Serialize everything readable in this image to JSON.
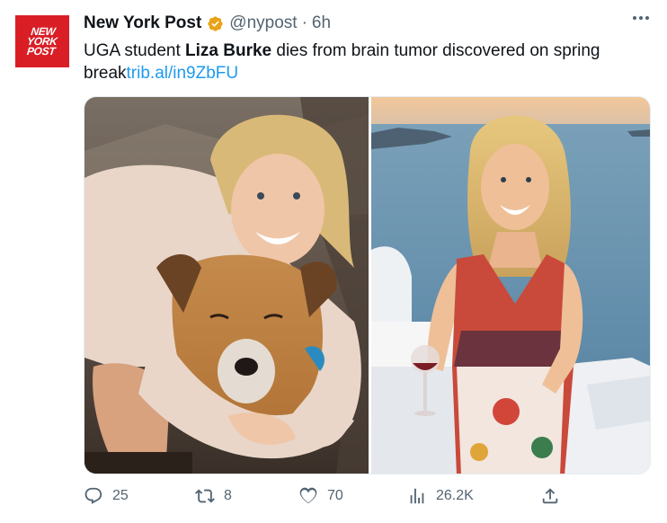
{
  "account": {
    "avatar_logo_lines": [
      "NEW",
      "YORK",
      "POST"
    ],
    "name": "New York Post",
    "handle": "@nypost",
    "separator": "·",
    "time": "6h",
    "verified_color": "#e8a317"
  },
  "tweet": {
    "text_before": "UGA student ",
    "text_bold": "Liza Burke",
    "text_after": " dies from brain tumor discovered on spring break",
    "link": "trib.al/in9ZbFU"
  },
  "media": {
    "left_photo_icon": "photo-woman-hugging-dog-icon",
    "right_photo_icon": "photo-woman-holding-wine-sunset-icon"
  },
  "actions": {
    "reply_count": "25",
    "retweet_count": "8",
    "like_count": "70",
    "views_count": "26.2K"
  },
  "colors": {
    "brand_red": "#d91e26",
    "link_blue": "#1d9bf0",
    "muted": "#536471"
  }
}
